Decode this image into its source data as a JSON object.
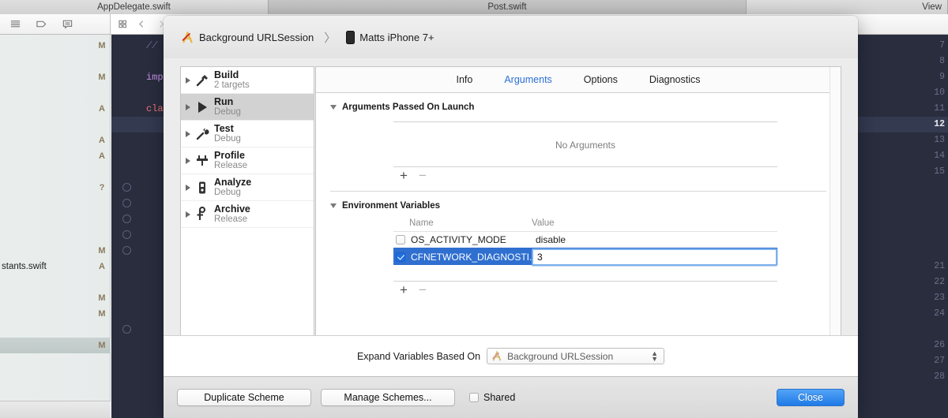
{
  "background": {
    "tabs": [
      {
        "label": "AppDelegate.swift"
      },
      {
        "label": "Post.swift"
      },
      {
        "label": "View"
      }
    ],
    "toolbar_icons": [
      "list-lines-icon",
      "tag-icon",
      "comment-icon",
      "grid-icon",
      "back-chevron-icon",
      "forward-chevron-icon"
    ],
    "navigator": {
      "rows": [
        {
          "name": "",
          "status": "M"
        },
        {
          "name": "",
          "status": ""
        },
        {
          "name": "",
          "status": "M"
        },
        {
          "name": "",
          "status": ""
        },
        {
          "name": "",
          "status": "A"
        },
        {
          "name": "",
          "status": ""
        },
        {
          "name": "",
          "status": "A"
        },
        {
          "name": "",
          "status": "A"
        },
        {
          "name": "",
          "status": ""
        },
        {
          "name": "",
          "status": "?"
        },
        {
          "name": "",
          "status": ""
        },
        {
          "name": "",
          "status": ""
        },
        {
          "name": "",
          "status": ""
        },
        {
          "name": "",
          "status": "M"
        },
        {
          "name": "stants.swift",
          "status": "A"
        },
        {
          "name": "",
          "status": ""
        },
        {
          "name": "",
          "status": "M"
        },
        {
          "name": "",
          "status": "M"
        },
        {
          "name": "",
          "status": ""
        },
        {
          "name": "",
          "status": "M",
          "selected": true
        }
      ]
    },
    "editor": {
      "lines": [
        {
          "num": "7",
          "code": "//",
          "kind": "comment"
        },
        {
          "num": "8",
          "code": "",
          "kind": "plain"
        },
        {
          "num": "9",
          "code": "impo",
          "kind": "keyword"
        },
        {
          "num": "10",
          "code": "",
          "kind": "plain"
        },
        {
          "num": "11",
          "code": "clas",
          "kind": "keyword2"
        },
        {
          "num": "12",
          "code": "",
          "kind": "plain",
          "current": true
        },
        {
          "num": "13",
          "code": "",
          "kind": "plain"
        },
        {
          "num": "14",
          "code": "",
          "kind": "plain"
        },
        {
          "num": "15",
          "code": "",
          "kind": "plain"
        },
        {
          "num": "",
          "code": "",
          "kind": "plain",
          "breakpoint": true
        },
        {
          "num": "",
          "code": "",
          "kind": "plain",
          "breakpoint": true
        },
        {
          "num": "",
          "code": "",
          "kind": "plain",
          "breakpoint": true
        },
        {
          "num": "",
          "code": "",
          "kind": "plain",
          "breakpoint": true
        },
        {
          "num": "",
          "code": "",
          "kind": "plain",
          "breakpoint": true
        },
        {
          "num": "21",
          "code": "",
          "kind": "plain"
        },
        {
          "num": "22",
          "code": "",
          "kind": "plain"
        },
        {
          "num": "23",
          "code": "",
          "kind": "plain"
        },
        {
          "num": "24",
          "code": "",
          "kind": "plain"
        },
        {
          "num": "",
          "code": "",
          "kind": "plain",
          "breakpoint": true
        },
        {
          "num": "26",
          "code": "",
          "kind": "plain"
        },
        {
          "num": "27",
          "code": "",
          "kind": "plain"
        },
        {
          "num": "28",
          "code": "",
          "kind": "plain"
        }
      ]
    }
  },
  "sheet": {
    "breadcrumb": {
      "scheme_icon": "scheme-icon",
      "scheme": "Background URLSession",
      "separator": "〉",
      "device_icon": "iphone-icon",
      "device": "Matts iPhone 7+"
    },
    "actions": [
      {
        "icon": "hammer-icon",
        "title": "Build",
        "subtitle": "2 targets",
        "selected": false
      },
      {
        "icon": "play-icon",
        "title": "Run",
        "subtitle": "Debug",
        "selected": true
      },
      {
        "icon": "wrench-icon",
        "title": "Test",
        "subtitle": "Debug",
        "selected": false
      },
      {
        "icon": "gauge-icon",
        "title": "Profile",
        "subtitle": "Release",
        "selected": false
      },
      {
        "icon": "analyze-icon",
        "title": "Analyze",
        "subtitle": "Debug",
        "selected": false
      },
      {
        "icon": "archive-icon",
        "title": "Archive",
        "subtitle": "Release",
        "selected": false
      }
    ],
    "tabs": [
      {
        "label": "Info",
        "active": false
      },
      {
        "label": "Arguments",
        "active": true
      },
      {
        "label": "Options",
        "active": false
      },
      {
        "label": "Diagnostics",
        "active": false
      }
    ],
    "arguments_section": {
      "title": "Arguments Passed On Launch",
      "empty_message": "No Arguments",
      "add_label": "+",
      "remove_label": "−"
    },
    "env_section": {
      "title": "Environment Variables",
      "columns": [
        "Name",
        "Value"
      ],
      "rows": [
        {
          "checked": false,
          "name": "OS_ACTIVITY_MODE",
          "value": "disable",
          "selected": false
        },
        {
          "checked": true,
          "name": "CFNETWORK_DIAGNOSTI...",
          "value": "3",
          "selected": true
        }
      ],
      "add_label": "+",
      "remove_label": "−"
    },
    "expand": {
      "label": "Expand Variables Based On",
      "value": "Background URLSession",
      "icon": "scheme-icon",
      "stepper_icon": "updown-arrows-icon"
    },
    "footer": {
      "duplicate_scheme": "Duplicate Scheme",
      "manage_schemes": "Manage Schemes...",
      "shared_label": "Shared",
      "shared_checked": false,
      "close": "Close"
    }
  },
  "colors": {
    "accent_blue": "#2d6fd8",
    "selection_blue": "#2f6fd0",
    "close_button": "#1f7ae6",
    "editor_bg": "#292d3e"
  }
}
